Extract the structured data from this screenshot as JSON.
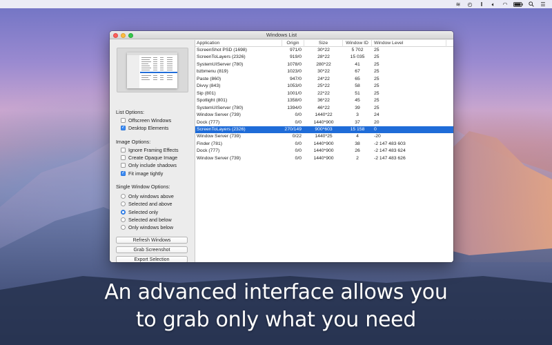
{
  "menubar": {
    "icons": [
      "layers-icon",
      "clock-icon",
      "pause-icon",
      "volume-icon",
      "wifi-icon",
      "battery-icon",
      "search-icon",
      "list-icon"
    ]
  },
  "window": {
    "title": "Windows List"
  },
  "sidebar": {
    "list_options": {
      "title": "List Options:",
      "items": [
        {
          "label": "Offscreen Windows",
          "checked": false
        },
        {
          "label": "Desktop Elements",
          "checked": true
        }
      ]
    },
    "image_options": {
      "title": "Image Options:",
      "items": [
        {
          "label": "Ignore Framing Effects",
          "checked": false
        },
        {
          "label": "Create Opaque Image",
          "checked": false
        },
        {
          "label": "Only include shadows",
          "checked": false
        },
        {
          "label": "Fit image tightly",
          "checked": true
        }
      ]
    },
    "single_window_options": {
      "title": "Single Window Options:",
      "items": [
        {
          "label": "Only windows above",
          "selected": false
        },
        {
          "label": "Selected and above",
          "selected": false
        },
        {
          "label": "Selected only",
          "selected": true
        },
        {
          "label": "Selected and below",
          "selected": false
        },
        {
          "label": "Only windows below",
          "selected": false
        }
      ]
    },
    "buttons": {
      "refresh": "Refresh Windows",
      "grab": "Grab Screenshot",
      "export": "Export Selection"
    }
  },
  "table": {
    "columns": [
      "Application",
      "Origin",
      "Size",
      "Window ID",
      "Window Level"
    ],
    "selected_index": 11,
    "rows": [
      [
        "ScreenShot PSD (1698)",
        "971/0",
        "30*22",
        "5 702",
        "25"
      ],
      [
        "ScreenToLayers (2326)",
        "919/0",
        "28*22",
        "15 035",
        "25"
      ],
      [
        "SystemUIServer (780)",
        "1078/0",
        "280*22",
        "41",
        "25"
      ],
      [
        "bzbmenu (819)",
        "1023/0",
        "30*22",
        "67",
        "25"
      ],
      [
        "Paste (860)",
        "947/0",
        "24*22",
        "65",
        "25"
      ],
      [
        "Divvy (843)",
        "1053/0",
        "25*22",
        "58",
        "25"
      ],
      [
        "Sip (801)",
        "1001/0",
        "22*22",
        "51",
        "25"
      ],
      [
        "Spotlight (801)",
        "1358/0",
        "36*22",
        "45",
        "25"
      ],
      [
        "SystemUIServer (780)",
        "1394/0",
        "46*22",
        "39",
        "25"
      ],
      [
        "Window Server (739)",
        "0/0",
        "1440*22",
        "3",
        "24"
      ],
      [
        "Dock (777)",
        "0/0",
        "1440*900",
        "37",
        "20"
      ],
      [
        "ScreenToLayers (2326)",
        "270/149",
        "900*603",
        "15 158",
        "0"
      ],
      [
        "Window Server (739)",
        "0/22",
        "1440*25",
        "4",
        "-20"
      ],
      [
        "Finder (781)",
        "0/0",
        "1440*900",
        "38",
        "-2 147 483 603"
      ],
      [
        "Dock (777)",
        "0/0",
        "1440*900",
        "26",
        "-2 147 483 624"
      ],
      [
        "Window Server (739)",
        "0/0",
        "1440*900",
        "2",
        "-2 147 483 626"
      ]
    ]
  },
  "caption": {
    "line1": "An advanced interface allows you",
    "line2": "to grab only what you need"
  },
  "colors": {
    "selection": "#1f6cd8",
    "checkbox_on": "#3b8cf5"
  }
}
